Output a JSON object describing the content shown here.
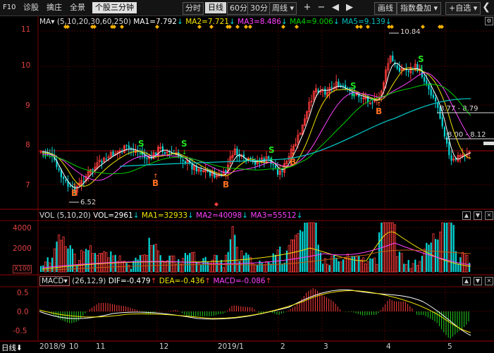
{
  "toolbar": {
    "f10": "F10",
    "diagnose": "诊股",
    "select": "擒庄",
    "fullview": "全景",
    "stock_3min": "个股三分钟",
    "period_fenshi": "分时",
    "period_daily": "日线",
    "period_60": "60分",
    "period_30": "30分",
    "period_weekly": "周线",
    "draw_line": "画线",
    "index_overlay": "指数叠加",
    "add_favorite": "+自选",
    "plus": "+",
    "minus": "−"
  },
  "main_legend": {
    "ma_label": "MA",
    "params": "(5,10,20,30,60,250)",
    "ma1": "MA1=7.792",
    "ma2": "MA2=7.721",
    "ma3": "MA3=8.486",
    "ma4": "MA4=9.006",
    "ma5": "MA5=9.139"
  },
  "vol_legend": {
    "label": "VOL",
    "params": "(5,10,20)",
    "vol": "VOL=2961",
    "ma1": "MA1=32933",
    "ma2": "MA2=40098",
    "ma3": "MA3=55512"
  },
  "macd_legend": {
    "label": "MACD",
    "params": "(26,12,9)",
    "dif": "DIF=-0.479",
    "dea": "DEA=-0.436",
    "macd": "MACD=-0.086"
  },
  "price_axis": [
    "11",
    "10",
    "9",
    "8",
    "7"
  ],
  "vol_axis": [
    "4000",
    "2000",
    "X100"
  ],
  "macd_axis": [
    "0.5",
    "0.0",
    "-0.5"
  ],
  "annotations": {
    "high": "10.84",
    "low": "6.52",
    "range1": "8.77 - 8.79",
    "range2": "8.00 - 8.12"
  },
  "x_axis": {
    "period": "日线",
    "labels": [
      "2018/9",
      "10",
      "11",
      "12",
      "2019/1",
      "2",
      "3",
      "4",
      "5"
    ]
  },
  "colors": {
    "up": "#ff3b3b",
    "down": "#00d8d8",
    "ma1": "#ffffff",
    "ma2": "#f2e400",
    "ma3": "#ff40ff",
    "ma4": "#00d000",
    "ma5": "#00c0c0",
    "grid": "#7a0000"
  }
}
